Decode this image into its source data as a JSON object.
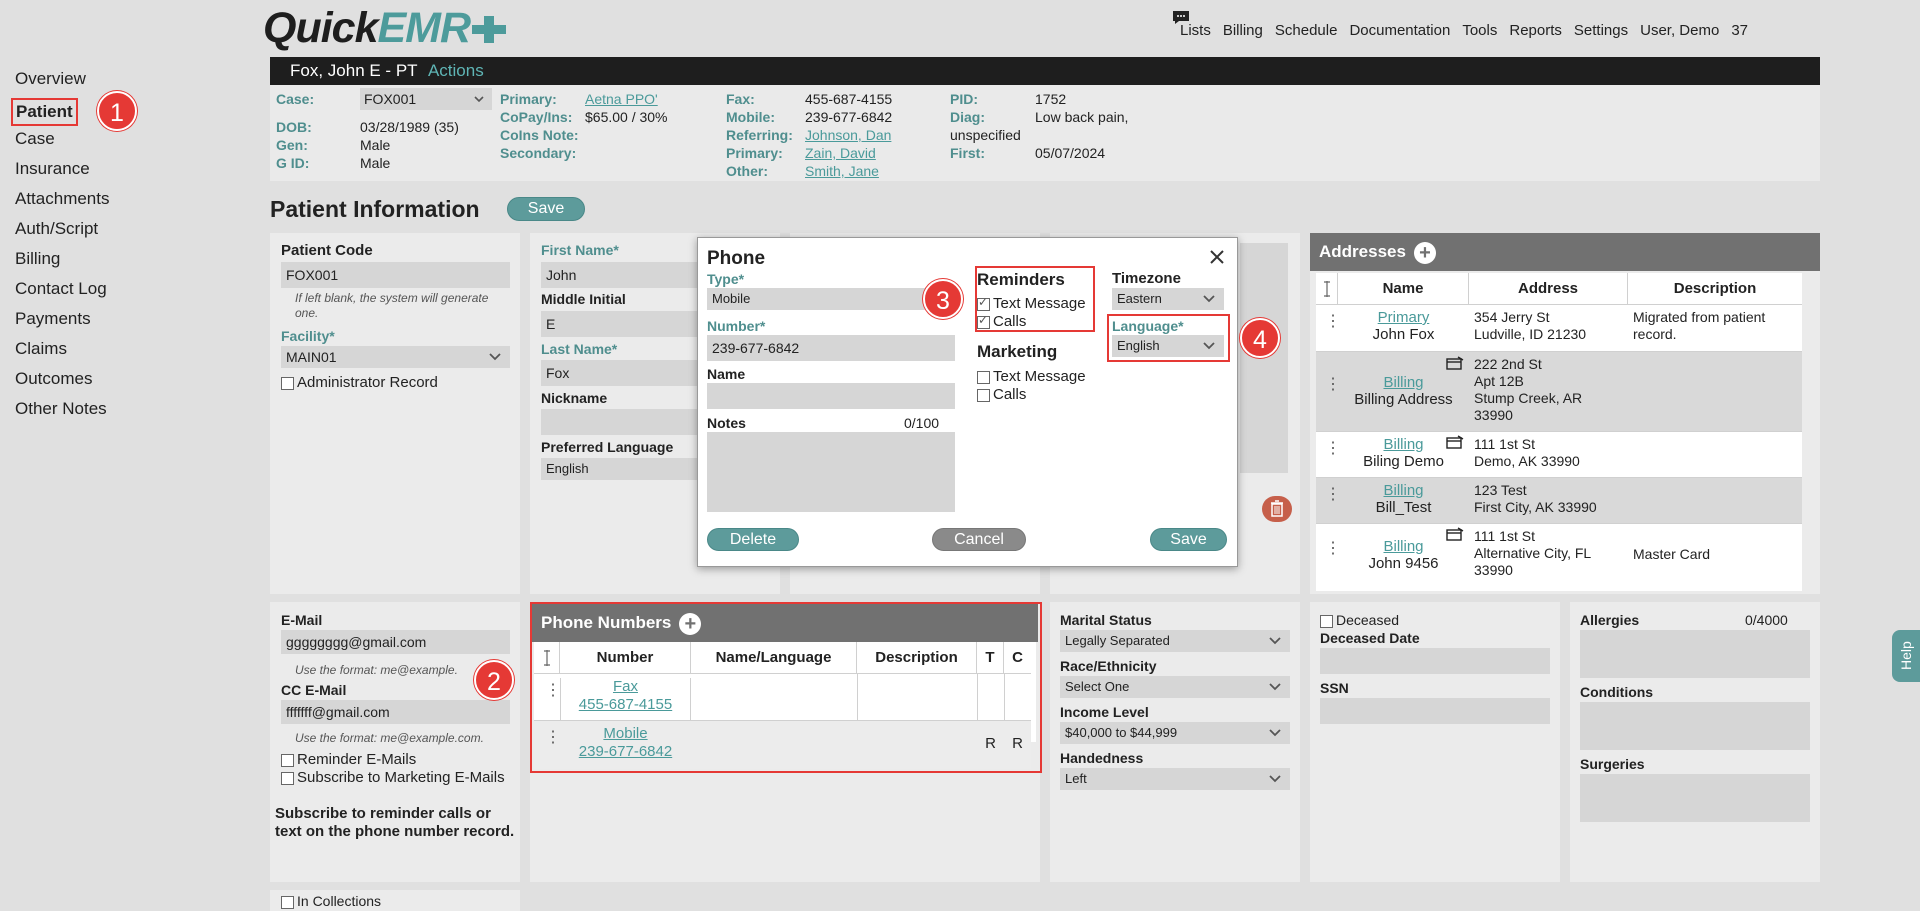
{
  "app": {
    "logo_quick": "Quick",
    "logo_emr": "EMR"
  },
  "topnav": [
    "Lists",
    "Billing",
    "Schedule",
    "Documentation",
    "Tools",
    "Reports",
    "Settings",
    "User, Demo",
    "37"
  ],
  "sidebar": [
    "Overview",
    "Patient",
    "Case",
    "Insurance",
    "Attachments",
    "Auth/Script",
    "Billing",
    "Contact Log",
    "Payments",
    "Claims",
    "Outcomes",
    "Other Notes"
  ],
  "badges": [
    "1",
    "2",
    "3",
    "4"
  ],
  "header": {
    "patient": "Fox, John E - PT",
    "actions": "Actions"
  },
  "info": {
    "case_label": "Case:",
    "case_value": "FOX001",
    "dob_label": "DOB:",
    "dob_value": "03/28/1989 (35)",
    "gen_label": "Gen:",
    "gen_value": "Male",
    "gid_label": "G ID:",
    "gid_value": "Male",
    "primary_label": "Primary:",
    "primary_value": "Aetna PPO'",
    "copay_label": "CoPay/Ins:",
    "copay_value": "$65.00 / 30%",
    "coins_label": "CoIns Note:",
    "secondary_label": "Secondary:",
    "fax_label": "Fax:",
    "fax_value": "455-687-4155",
    "mobile_label": "Mobile:",
    "mobile_value": "239-677-6842",
    "referring_label": "Referring:",
    "referring_value": "Johnson, Dan",
    "primary2_label": "Primary:",
    "primary2_value": "Zain, David",
    "other_label": "Other:",
    "other_value": "Smith, Jane",
    "pid_label": "PID:",
    "pid_value": "1752",
    "diag_label": "Diag:",
    "diag_value": "Low back pain,",
    "diag_value2": "unspecified",
    "first_label": "First:",
    "first_value": "05/07/2024"
  },
  "page": {
    "title": "Patient Information",
    "save": "Save"
  },
  "left_card": {
    "patient_code_label": "Patient Code",
    "patient_code": "FOX001",
    "patient_code_hint": "If left blank, the system will generate one.",
    "facility_label": "Facility*",
    "facility": "MAIN01",
    "admin_label": "Administrator Record"
  },
  "name_card": {
    "first_label": "First Name*",
    "first": "John",
    "mi_label": "Middle Initial",
    "mi": "E",
    "last_label": "Last Name*",
    "last": "Fox",
    "nick_label": "Nickname",
    "pref_lang_label": "Preferred Language",
    "pref_lang": "English"
  },
  "phone_modal": {
    "title": "Phone",
    "type_label": "Type*",
    "type": "Mobile",
    "number_label": "Number*",
    "number": "239-677-6842",
    "name_label": "Name",
    "notes_label": "Notes",
    "notes_count": "0/100",
    "reminders_label": "Reminders",
    "rem_text": "Text Message",
    "rem_calls": "Calls",
    "marketing_label": "Marketing",
    "mkt_text": "Text Message",
    "mkt_calls": "Calls",
    "timezone_label": "Timezone",
    "timezone": "Eastern",
    "language_label": "Language*",
    "language": "English",
    "delete": "Delete",
    "cancel": "Cancel",
    "save": "Save"
  },
  "addresses": {
    "title": "Addresses",
    "headers": [
      "Name",
      "Address",
      "Description"
    ],
    "rows": [
      {
        "type": "Primary",
        "name": "John Fox",
        "addr": [
          "354 Jerry St",
          "Ludville, ID 21230"
        ],
        "desc": "Migrated from patient record."
      },
      {
        "type": "Billing",
        "name": "Billing Address",
        "addr": [
          "222 2nd St",
          "Apt 12B",
          "Stump Creek, AR",
          "33990"
        ],
        "desc": ""
      },
      {
        "type": "Billing",
        "name": "Biling Demo",
        "addr": [
          "111 1st St",
          "Demo, AK 33990"
        ],
        "desc": ""
      },
      {
        "type": "Billing",
        "name": "Bill_Test",
        "addr": [
          "123 Test",
          "First City, AK 33990"
        ],
        "desc": ""
      },
      {
        "type": "Billing",
        "name": "John 9456",
        "addr": [
          "111 1st St",
          "Alternative City, FL",
          "33990"
        ],
        "desc": "Master Card"
      }
    ]
  },
  "email_card": {
    "email_label": "E-Mail",
    "email": "gggggggg@gmail.com",
    "email_hint": "Use the format: me@example.",
    "cc_label": "CC E-Mail",
    "cc": "fffffff@gmail.com",
    "cc_hint": "Use the format: me@example.com.",
    "reminder_label": "Reminder E-Mails",
    "subscribe_label": "Subscribe to Marketing E-Mails",
    "note": "Subscribe to reminder calls or text on the phone number record.",
    "collections": "In Collections"
  },
  "phones": {
    "title": "Phone Numbers",
    "headers": [
      "Number",
      "Name/Language",
      "Description",
      "T",
      "C"
    ],
    "rows": [
      {
        "type": "Fax",
        "number": "455-687-4155",
        "t": "",
        "c": ""
      },
      {
        "type": "Mobile",
        "number": "239-677-6842",
        "t": "R",
        "c": "R"
      }
    ]
  },
  "demo_card": {
    "marital_label": "Marital Status",
    "marital": "Legally Separated",
    "race_label": "Race/Ethnicity",
    "race": "Select One",
    "income_label": "Income Level",
    "income": "$40,000 to $44,999",
    "hand_label": "Handedness",
    "hand": "Left"
  },
  "deceased_card": {
    "deceased_label": "Deceased",
    "date_label": "Deceased Date",
    "ssn_label": "SSN"
  },
  "medical_card": {
    "allergies_label": "Allergies",
    "allergies_count": "0/4000",
    "conditions_label": "Conditions",
    "surgeries_label": "Surgeries"
  },
  "help": "Help"
}
